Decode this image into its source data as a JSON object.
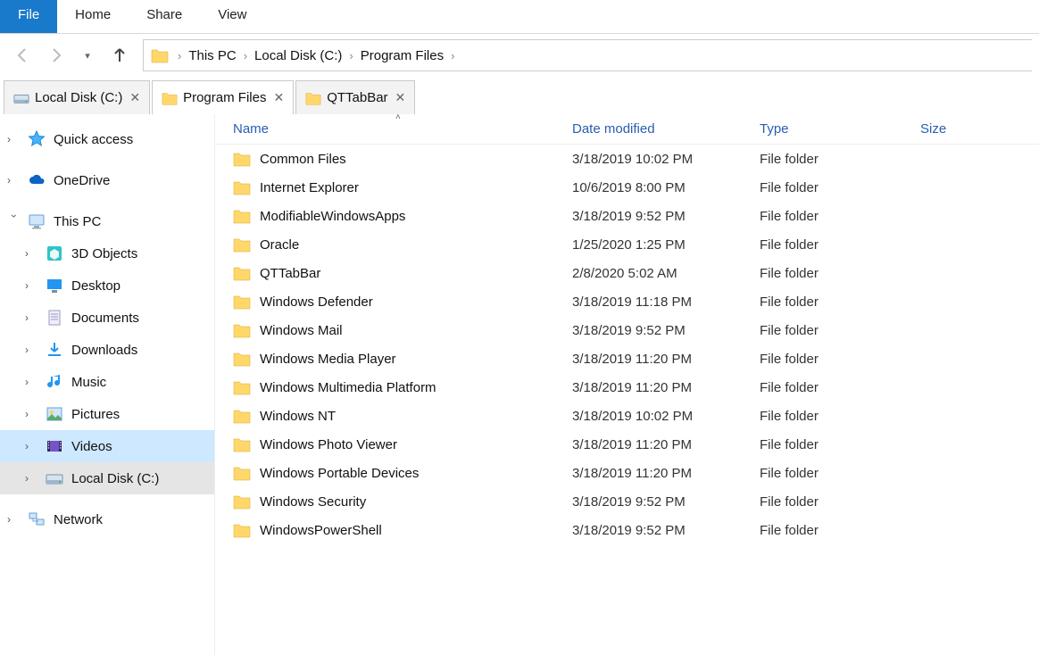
{
  "ribbon": {
    "file": "File",
    "home": "Home",
    "share": "Share",
    "view": "View"
  },
  "breadcrumb": [
    "This PC",
    "Local Disk (C:)",
    "Program Files"
  ],
  "tabs": [
    {
      "label": "Local Disk (C:)",
      "icon": "drive",
      "active": false
    },
    {
      "label": "Program Files",
      "icon": "folder",
      "active": true
    },
    {
      "label": "QTTabBar",
      "icon": "folder",
      "active": false
    }
  ],
  "sidebar": {
    "quick_access": "Quick access",
    "onedrive": "OneDrive",
    "this_pc": "This PC",
    "children": [
      {
        "label": "3D Objects",
        "icon": "3d"
      },
      {
        "label": "Desktop",
        "icon": "desktop"
      },
      {
        "label": "Documents",
        "icon": "documents"
      },
      {
        "label": "Downloads",
        "icon": "downloads"
      },
      {
        "label": "Music",
        "icon": "music"
      },
      {
        "label": "Pictures",
        "icon": "pictures"
      },
      {
        "label": "Videos",
        "icon": "videos",
        "selected": "sel"
      },
      {
        "label": "Local Disk (C:)",
        "icon": "drive",
        "selected": "selgrey"
      }
    ],
    "network": "Network"
  },
  "columns": {
    "name": "Name",
    "date": "Date modified",
    "type": "Type",
    "size": "Size"
  },
  "files": [
    {
      "name": "Common Files",
      "date": "3/18/2019 10:02 PM",
      "type": "File folder"
    },
    {
      "name": "Internet Explorer",
      "date": "10/6/2019 8:00 PM",
      "type": "File folder"
    },
    {
      "name": "ModifiableWindowsApps",
      "date": "3/18/2019 9:52 PM",
      "type": "File folder"
    },
    {
      "name": "Oracle",
      "date": "1/25/2020 1:25 PM",
      "type": "File folder"
    },
    {
      "name": "QTTabBar",
      "date": "2/8/2020 5:02 AM",
      "type": "File folder"
    },
    {
      "name": "Windows Defender",
      "date": "3/18/2019 11:18 PM",
      "type": "File folder"
    },
    {
      "name": "Windows Mail",
      "date": "3/18/2019 9:52 PM",
      "type": "File folder"
    },
    {
      "name": "Windows Media Player",
      "date": "3/18/2019 11:20 PM",
      "type": "File folder"
    },
    {
      "name": "Windows Multimedia Platform",
      "date": "3/18/2019 11:20 PM",
      "type": "File folder"
    },
    {
      "name": "Windows NT",
      "date": "3/18/2019 10:02 PM",
      "type": "File folder"
    },
    {
      "name": "Windows Photo Viewer",
      "date": "3/18/2019 11:20 PM",
      "type": "File folder"
    },
    {
      "name": "Windows Portable Devices",
      "date": "3/18/2019 11:20 PM",
      "type": "File folder"
    },
    {
      "name": "Windows Security",
      "date": "3/18/2019 9:52 PM",
      "type": "File folder"
    },
    {
      "name": "WindowsPowerShell",
      "date": "3/18/2019 9:52 PM",
      "type": "File folder"
    }
  ]
}
